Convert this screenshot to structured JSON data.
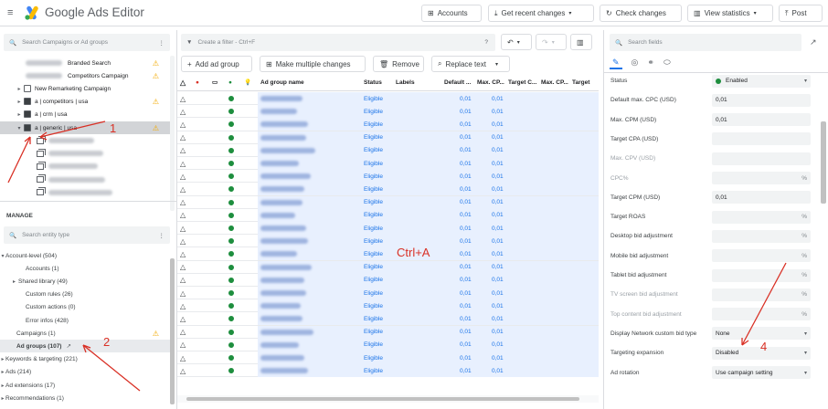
{
  "app": {
    "title": "Google Ads Editor"
  },
  "toolbar": {
    "accounts": "Accounts",
    "get_recent_changes": "Get recent changes",
    "check_changes": "Check changes",
    "view_statistics": "View statistics",
    "post": "Post"
  },
  "left": {
    "search_placeholder": "Search Campaigns or Ad groups",
    "campaigns": [
      {
        "label": "Branded Search",
        "warn": true
      },
      {
        "label": "Competitors Campaign",
        "warn": true
      },
      {
        "label": "New Remarketing Campaign",
        "warn": false
      },
      {
        "label": "a | competitors | usa",
        "warn": true
      },
      {
        "label": "a | crm | usa",
        "warn": false
      },
      {
        "label": "a | generic | usa",
        "warn": true
      }
    ],
    "manage_title": "MANAGE",
    "entity_placeholder": "Search entity type",
    "manage_items": [
      {
        "label": "Account-level (504)",
        "indent": 0,
        "caret": "▾"
      },
      {
        "label": "Accounts (1)",
        "indent": 1,
        "caret": ""
      },
      {
        "label": "Shared library (49)",
        "indent": 1,
        "caret": "▸"
      },
      {
        "label": "Custom rules (26)",
        "indent": 1,
        "caret": ""
      },
      {
        "label": "Custom actions (0)",
        "indent": 1,
        "caret": ""
      },
      {
        "label": "Error infos (428)",
        "indent": 1,
        "caret": ""
      },
      {
        "label": "Campaigns (1)",
        "indent": 0,
        "caret": ""
      },
      {
        "label": "Ad groups (107)",
        "indent": 0,
        "caret": ""
      },
      {
        "label": "Keywords & targeting (221)",
        "indent": 0,
        "caret": "▸"
      },
      {
        "label": "Ads (214)",
        "indent": 0,
        "caret": "▸"
      },
      {
        "label": "Ad extensions (17)",
        "indent": 0,
        "caret": "▸"
      },
      {
        "label": "Recommendations (1)",
        "indent": 0,
        "caret": "▸"
      }
    ]
  },
  "middle": {
    "filter_placeholder": "Create a filter - Ctrl+F",
    "add_ad_group": "Add ad group",
    "make_multiple_changes": "Make multiple changes",
    "remove": "Remove",
    "replace_text": "Replace text",
    "columns": {
      "ad_group_name": "Ad group name",
      "status": "Status",
      "labels": "Labels",
      "default": "Default ...",
      "max_cp": "Max. CP...",
      "target_c": "Target C...",
      "max_cp2": "Max. CP...",
      "target": "Target"
    },
    "row_status": "Eligible",
    "row_default": "0,01",
    "row_max": "0,01",
    "row_count": 22,
    "overlay": "Ctrl+A"
  },
  "right": {
    "search_placeholder": "Search fields",
    "properties": [
      {
        "label": "Status",
        "value": "Enabled",
        "type": "status"
      },
      {
        "label": "Default max. CPC (USD)",
        "value": "0,01",
        "type": "text"
      },
      {
        "label": "Max. CPM (USD)",
        "value": "0,01",
        "type": "text"
      },
      {
        "label": "Target CPA (USD)",
        "value": "",
        "type": "text"
      },
      {
        "label": "Max. CPV (USD)",
        "value": "",
        "type": "disabled"
      },
      {
        "label": "CPC%",
        "value": "",
        "type": "pct-disabled"
      },
      {
        "label": "Target CPM (USD)",
        "value": "0,01",
        "type": "text"
      },
      {
        "label": "Target ROAS",
        "value": "",
        "type": "pct"
      },
      {
        "label": "Desktop bid adjustment",
        "value": "",
        "type": "pct"
      },
      {
        "label": "Mobile bid adjustment",
        "value": "",
        "type": "pct"
      },
      {
        "label": "Tablet bid adjustment",
        "value": "",
        "type": "pct"
      },
      {
        "label": "TV screen bid adjustment",
        "value": "",
        "type": "pct-disabled"
      },
      {
        "label": "Top content bid adjustment",
        "value": "",
        "type": "pct-disabled"
      },
      {
        "label": "Display Network custom bid type",
        "value": "None",
        "type": "dropdown"
      },
      {
        "label": "Targeting expansion",
        "value": "Disabled",
        "type": "dropdown"
      },
      {
        "label": "Ad rotation",
        "value": "Use campaign setting",
        "type": "dropdown"
      }
    ]
  },
  "annotations": [
    "1",
    "2",
    "4"
  ],
  "colors": {
    "accent": "#1a73e8",
    "annotation": "#d93025",
    "warning": "#f2a900",
    "enabled": "#1e8e3e"
  }
}
